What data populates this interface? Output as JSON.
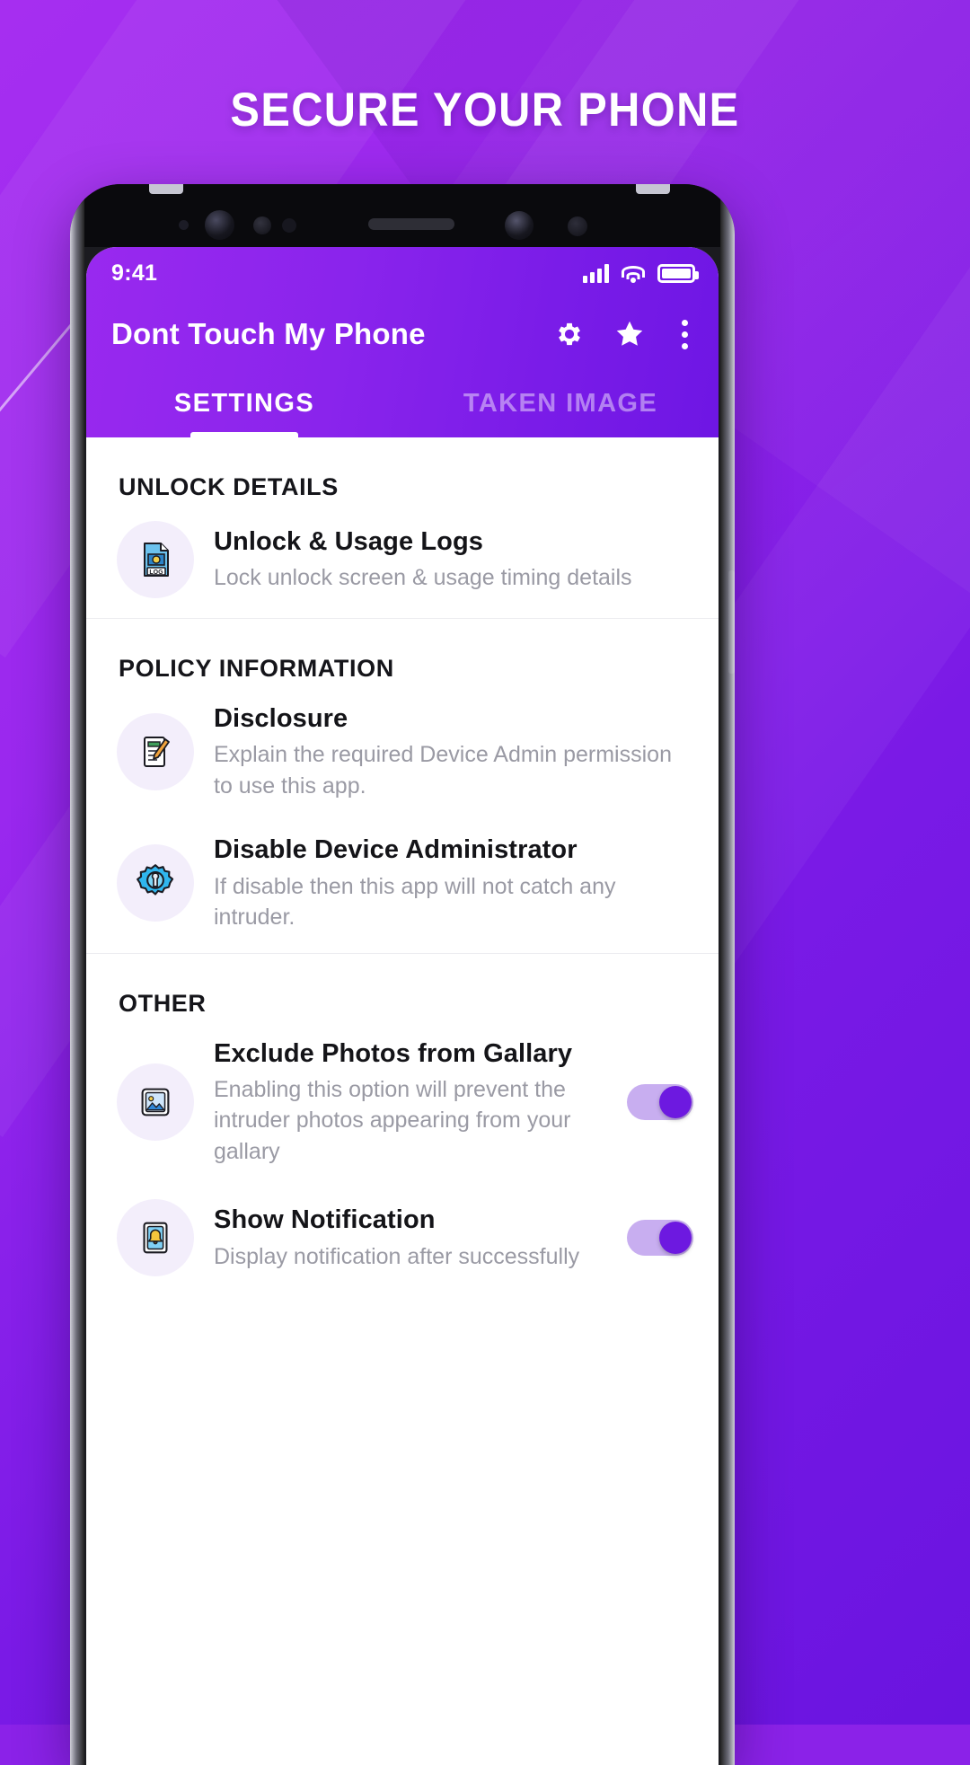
{
  "promo": {
    "headline": "SECURE YOUR PHONE",
    "accent_color": "#8b22e8",
    "headline_color": "#ffffff"
  },
  "status_bar": {
    "time": "9:41",
    "icons": [
      "signal-bars-icon",
      "wifi-icon",
      "battery-icon"
    ]
  },
  "app_bar": {
    "title": "Dont Touch My Phone",
    "actions": [
      {
        "name": "gear-icon",
        "label": "Settings"
      },
      {
        "name": "star-icon",
        "label": "Rate"
      },
      {
        "name": "overflow-menu-icon",
        "label": "More options"
      }
    ]
  },
  "tabs": [
    {
      "label": "SETTINGS",
      "active": true
    },
    {
      "label": "TAKEN IMAGE",
      "active": false
    }
  ],
  "sections": [
    {
      "title": "UNLOCK DETAILS",
      "rows": [
        {
          "icon": "log-document-icon",
          "title": "Unlock & Usage Logs",
          "subtitle": "Lock unlock screen & usage timing details",
          "toggle": null
        }
      ]
    },
    {
      "title": "POLICY INFORMATION",
      "rows": [
        {
          "icon": "document-pencil-icon",
          "title": "Disclosure",
          "subtitle": "Explain the required Device Admin  permission to use this app.",
          "toggle": null
        },
        {
          "icon": "gear-wrench-icon",
          "title": "Disable Device Administrator",
          "subtitle": "If disable then this app will not catch any intruder.",
          "toggle": null
        }
      ]
    },
    {
      "title": "OTHER",
      "rows": [
        {
          "icon": "photo-image-icon",
          "title": "Exclude Photos from Gallary",
          "subtitle": "Enabling this option will prevent the intruder photos appearing from your gallary",
          "toggle": "on"
        },
        {
          "icon": "notification-bell-icon",
          "title": "Show Notification",
          "subtitle": "Display notification after successfully",
          "toggle": "on"
        }
      ]
    }
  ]
}
